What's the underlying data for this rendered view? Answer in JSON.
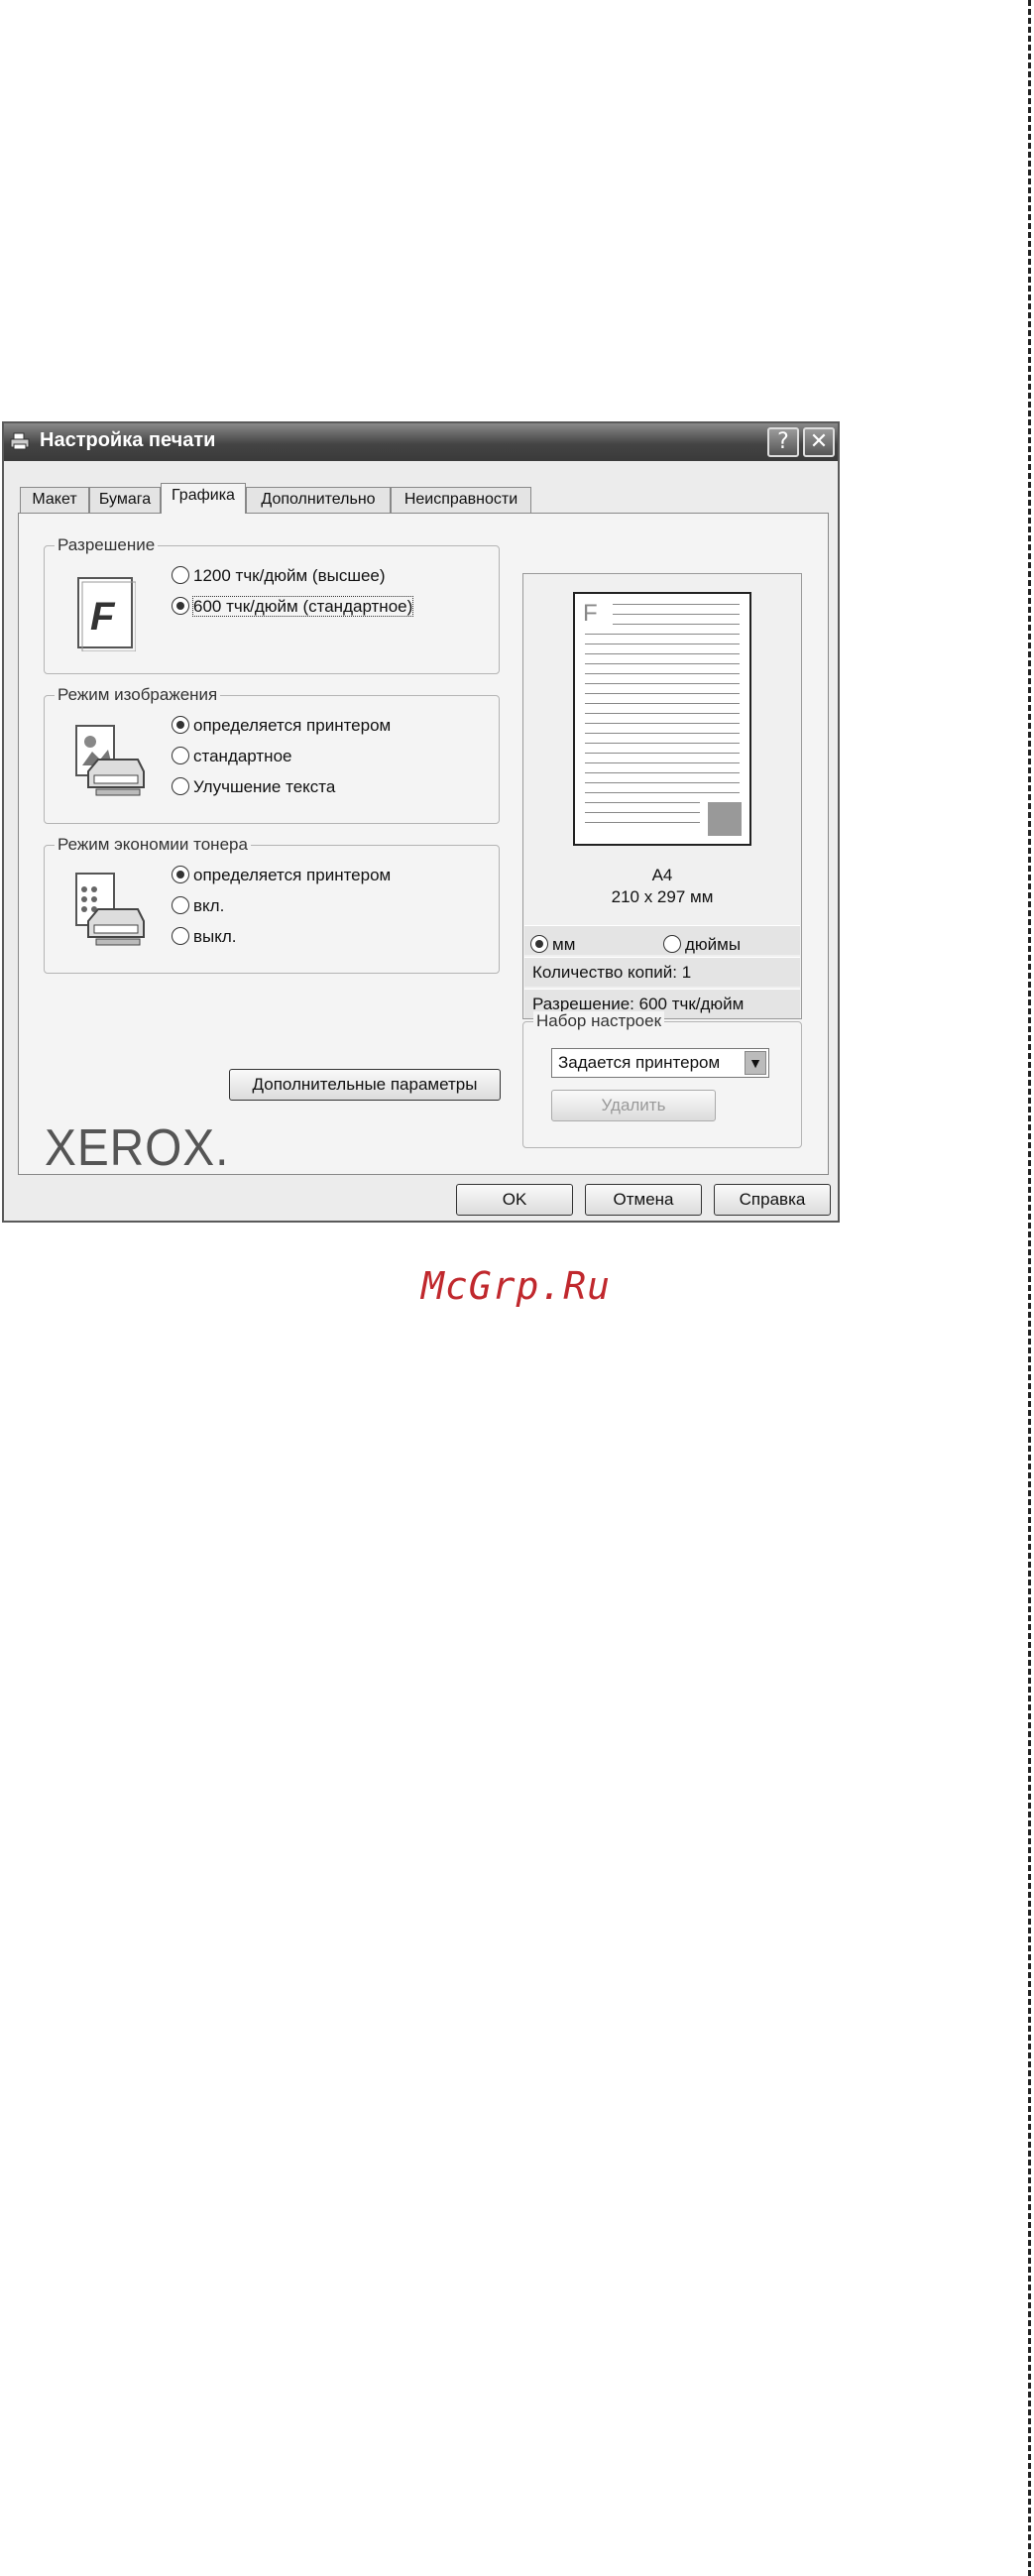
{
  "window": {
    "title": "Настройка печати",
    "help_button": "?",
    "close_button": "✕"
  },
  "tabs": [
    {
      "label": "Макет"
    },
    {
      "label": "Бумага"
    },
    {
      "label": "Графика",
      "active": true
    },
    {
      "label": "Дополнительно"
    },
    {
      "label": "Неисправности"
    }
  ],
  "resolution": {
    "title": "Разрешение",
    "icon": "F",
    "options": [
      {
        "label": "1200 тчк/дюйм (высшее)",
        "selected": false
      },
      {
        "label": "600 тчк/дюйм (стандартное)",
        "selected": true
      }
    ]
  },
  "image_mode": {
    "title": "Режим изображения",
    "options": [
      {
        "label": "определяется принтером",
        "selected": true
      },
      {
        "label": "стандартное",
        "selected": false
      },
      {
        "label": "Улучшение текста",
        "selected": false
      }
    ]
  },
  "toner_save": {
    "title": "Режим экономии тонера",
    "options": [
      {
        "label": "определяется принтером",
        "selected": true
      },
      {
        "label": "вкл.",
        "selected": false
      },
      {
        "label": "выкл.",
        "selected": false
      }
    ]
  },
  "advanced_button": "Дополнительные параметры",
  "logo": "XEROX.",
  "preview": {
    "sheet_letter": "F",
    "paper_name": "A4",
    "paper_size": "210 x 297 мм",
    "units": [
      {
        "label": "мм",
        "selected": true
      },
      {
        "label": "дюймы",
        "selected": false
      }
    ],
    "copies": "Количество копий: 1",
    "resolution": "Разрешение: 600 тчк/дюйм"
  },
  "favorites": {
    "title": "Набор настроек",
    "selected": "Задается принтером",
    "delete_button": "Удалить"
  },
  "footer": {
    "ok": "OK",
    "cancel": "Отмена",
    "help": "Справка"
  },
  "watermark": "McGrp.Ru"
}
